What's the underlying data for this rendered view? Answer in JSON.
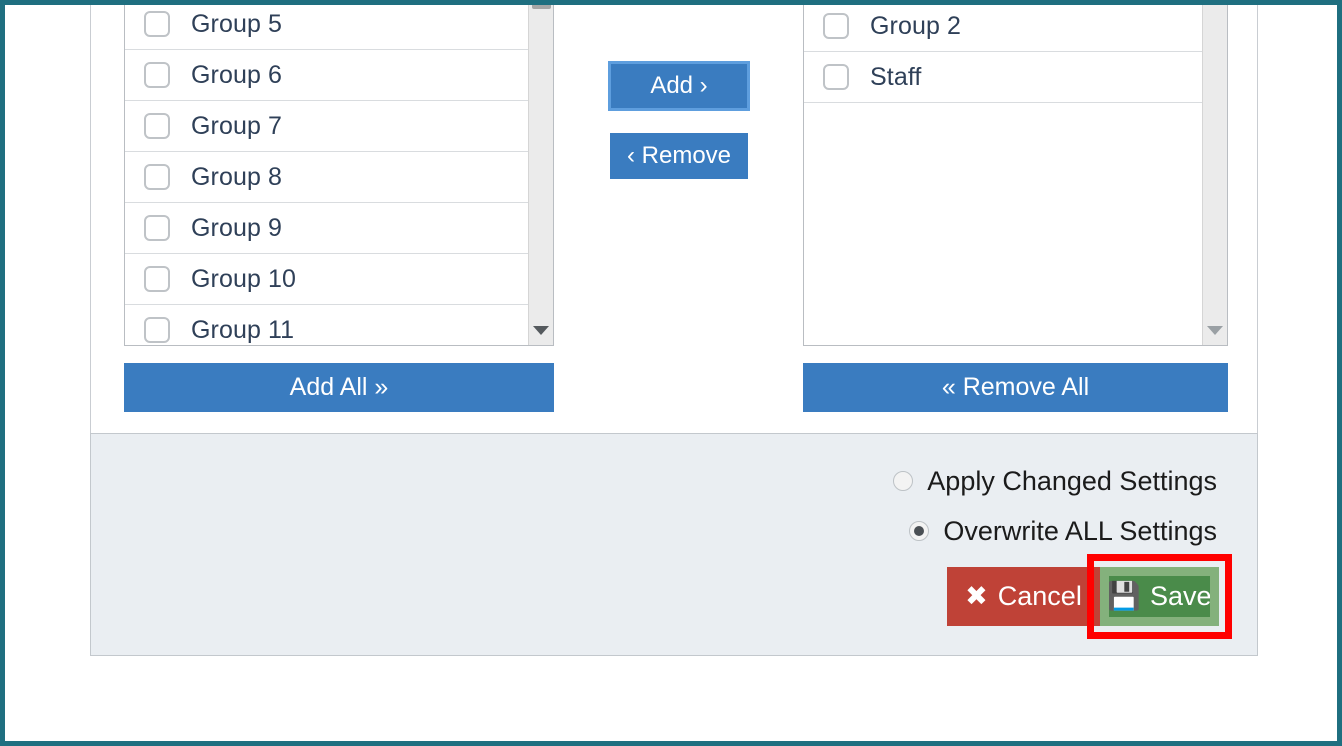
{
  "theme": {
    "frame_color": "#1f6f80",
    "primary_blue": "#3a7cc0",
    "focus_blue": "#5e9ede",
    "cancel_red": "#bf4237",
    "save_green": "#4a8b4a",
    "save_focus_green": "#84b17c",
    "highlight_red": "#ff0000",
    "panel_bg": "#eaeef2",
    "list_text": "#2f4058"
  },
  "available_list": {
    "name": "available-groups-list",
    "items": [
      {
        "label": "Group 5",
        "checked": false
      },
      {
        "label": "Group 6",
        "checked": false
      },
      {
        "label": "Group 7",
        "checked": false
      },
      {
        "label": "Group 8",
        "checked": false
      },
      {
        "label": "Group 9",
        "checked": false
      },
      {
        "label": "Group 10",
        "checked": false
      },
      {
        "label": "Group 11",
        "checked": false
      }
    ],
    "scrollbar": {
      "has_thumb": true,
      "arrow": "chevron-down-icon"
    }
  },
  "selected_list": {
    "name": "selected-groups-list",
    "items": [
      {
        "label": "Group 2",
        "checked": false
      },
      {
        "label": "Staff",
        "checked": false
      }
    ],
    "scrollbar": {
      "has_thumb": false,
      "arrow": "chevron-down-icon"
    }
  },
  "transfer_buttons": {
    "add": {
      "label": "Add ›",
      "focused": true
    },
    "remove": {
      "label": "‹ Remove",
      "focused": false
    },
    "add_all": {
      "label": "Add All »"
    },
    "remove_all": {
      "label": "« Remove All"
    }
  },
  "settings_mode": {
    "options": [
      {
        "label": "Apply Changed Settings",
        "selected": false
      },
      {
        "label": "Overwrite ALL Settings",
        "selected": true
      }
    ]
  },
  "actions": {
    "cancel": {
      "label": "Cancel",
      "icon": "✖"
    },
    "save": {
      "label": "Save",
      "icon": "💾",
      "focused": true,
      "annotated": true
    }
  }
}
